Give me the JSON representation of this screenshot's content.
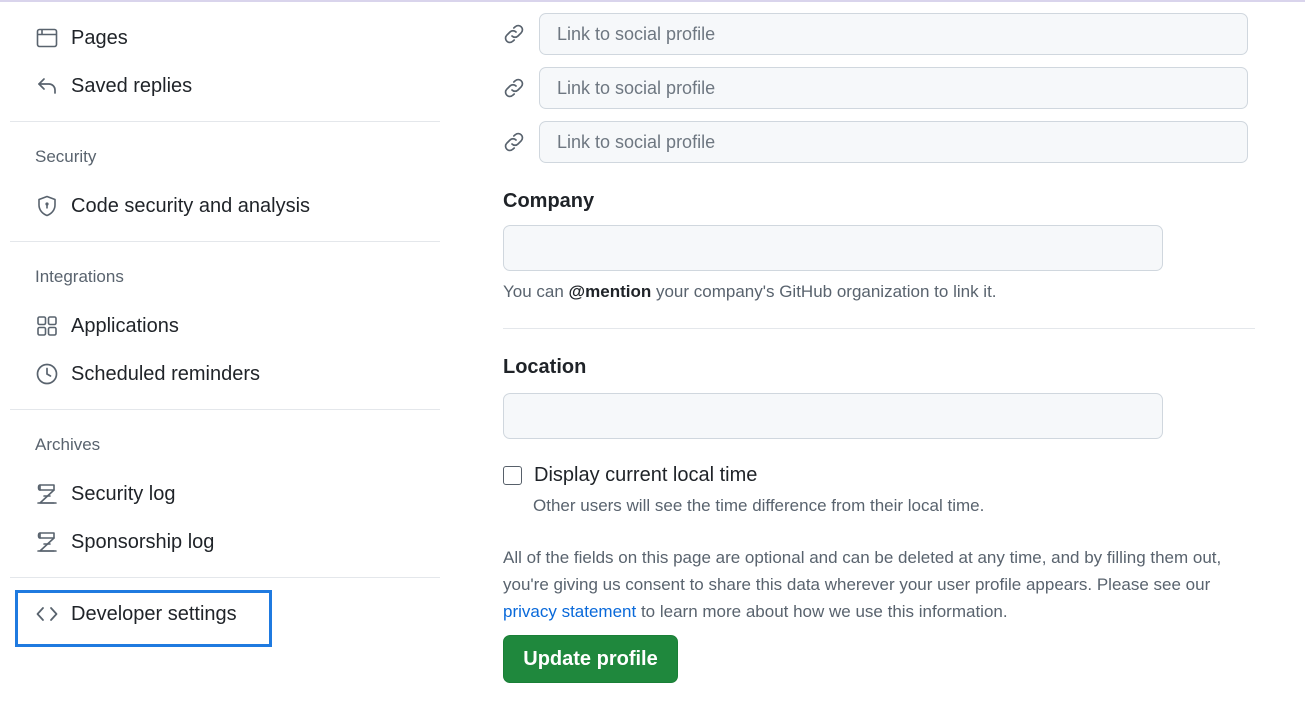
{
  "sidebar": {
    "top_items": [
      {
        "label": "Pages",
        "icon": "browser-icon"
      },
      {
        "label": "Saved replies",
        "icon": "reply-icon"
      }
    ],
    "sections": [
      {
        "heading": "Security",
        "items": [
          {
            "label": "Code security and analysis",
            "icon": "shield-icon"
          }
        ]
      },
      {
        "heading": "Integrations",
        "items": [
          {
            "label": "Applications",
            "icon": "apps-grid-icon"
          },
          {
            "label": "Scheduled reminders",
            "icon": "clock-icon"
          }
        ]
      },
      {
        "heading": "Archives",
        "items": [
          {
            "label": "Security log",
            "icon": "log-icon"
          },
          {
            "label": "Sponsorship log",
            "icon": "log-icon"
          }
        ]
      }
    ],
    "developer_settings": {
      "label": "Developer settings",
      "icon": "code-icon",
      "highlight_color": "#1f7ae0"
    }
  },
  "profile_form": {
    "social_links": [
      {
        "placeholder": "Link to social profile",
        "icon": "link-icon"
      },
      {
        "placeholder": "Link to social profile",
        "icon": "link-icon"
      },
      {
        "placeholder": "Link to social profile",
        "icon": "link-icon"
      }
    ],
    "company": {
      "label": "Company",
      "value": "",
      "hint_prefix": "You can ",
      "hint_mention": "@mention",
      "hint_suffix": " your company's GitHub organization to link it."
    },
    "location": {
      "label": "Location",
      "value": ""
    },
    "local_time": {
      "label": "Display current local time",
      "checked": false,
      "note": "Other users will see the time difference from their local time."
    },
    "consent": {
      "text_before": "All of the fields on this page are optional and can be deleted at any time, and by filling them out, you're giving us consent to share this data wherever your user profile appears. Please see our ",
      "link_text": "privacy statement",
      "text_after": " to learn more about how we use this information."
    },
    "submit_label": "Update profile"
  },
  "colors": {
    "primary_button": "#1f883d",
    "link": "#0969da",
    "muted_text": "#59636e"
  }
}
